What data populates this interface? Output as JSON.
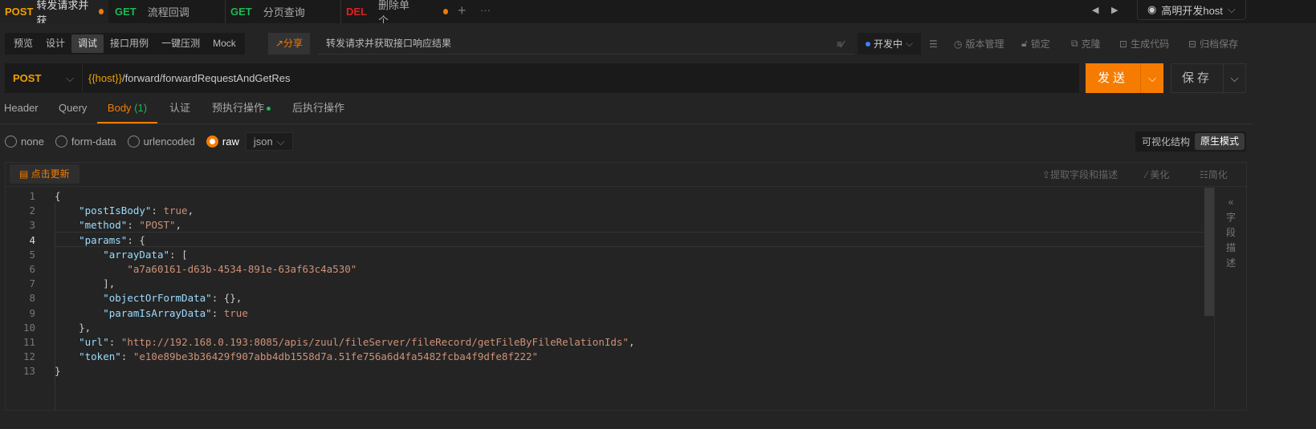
{
  "tabs": [
    {
      "method": "POST",
      "name": "转发请求并获",
      "method_color": "#f0a000",
      "modified": true,
      "active": true
    },
    {
      "method": "GET",
      "name": "流程回调",
      "method_color": "#1db954"
    },
    {
      "method": "GET",
      "name": "分页查询",
      "method_color": "#1db954"
    },
    {
      "method": "DEL",
      "name": "删除单个",
      "method_color": "#e02020",
      "modified": true
    }
  ],
  "tabbar": {
    "add_icon": "+",
    "more_icon": "···",
    "env": "高明开发host"
  },
  "modes": [
    "预览",
    "设计",
    "调试",
    "接口用例",
    "一键压测",
    "Mock"
  ],
  "active_mode": "调试",
  "share": "分享",
  "description": "转发请求并获取接口响应结果",
  "status": "开发中",
  "tools": [
    "版本管理",
    "锁定",
    "克隆",
    "生成代码",
    "归档保存"
  ],
  "request": {
    "method": "POST",
    "url_var": "{{host}}",
    "url_path": "/forward/forwardRequestAndGetRes",
    "send": "发送",
    "save": "保存"
  },
  "param_tabs": [
    {
      "label": "Header"
    },
    {
      "label": "Query"
    },
    {
      "label": "Body",
      "count": "(1)",
      "active": true
    },
    {
      "label": "认证"
    },
    {
      "label": "预执行操作",
      "dot": true
    },
    {
      "label": "后执行操作"
    }
  ],
  "body_types": [
    "none",
    "form-data",
    "urlencoded",
    "raw"
  ],
  "body_selected": "raw",
  "format": "json",
  "view_modes": [
    "可视化结构",
    "原生模式"
  ],
  "view_active": "原生模式",
  "editor_tools": {
    "refresh": "点击更新",
    "extract": "提取字段和描述",
    "beautify": "美化",
    "simplify": "简化",
    "side_panel": "字段描述"
  },
  "code": [
    [
      [
        "p",
        "{"
      ]
    ],
    [
      [
        "p",
        "    "
      ],
      [
        "k",
        "\"postIsBody\""
      ],
      [
        "p",
        ": "
      ],
      [
        "b",
        "true"
      ],
      [
        "p",
        ","
      ]
    ],
    [
      [
        "p",
        "    "
      ],
      [
        "k",
        "\"method\""
      ],
      [
        "p",
        ": "
      ],
      [
        "s",
        "\"POST\""
      ],
      [
        "p",
        ","
      ]
    ],
    [
      [
        "p",
        "    "
      ],
      [
        "k",
        "\"params\""
      ],
      [
        "p",
        ": {"
      ]
    ],
    [
      [
        "p",
        "        "
      ],
      [
        "k",
        "\"arrayData\""
      ],
      [
        "p",
        ": ["
      ]
    ],
    [
      [
        "p",
        "            "
      ],
      [
        "s",
        "\"a7a60161-d63b-4534-891e-63af63c4a530\""
      ]
    ],
    [
      [
        "p",
        "        ],"
      ]
    ],
    [
      [
        "p",
        "        "
      ],
      [
        "k",
        "\"objectOrFormData\""
      ],
      [
        "p",
        ": {},"
      ]
    ],
    [
      [
        "p",
        "        "
      ],
      [
        "k",
        "\"paramIsArrayData\""
      ],
      [
        "p",
        ": "
      ],
      [
        "b",
        "true"
      ]
    ],
    [
      [
        "p",
        "    },"
      ]
    ],
    [
      [
        "p",
        "    "
      ],
      [
        "k",
        "\"url\""
      ],
      [
        "p",
        ": "
      ],
      [
        "s",
        "\"http://192.168.0.193:8085/apis/zuul/fileServer/fileRecord/getFileByFileRelationIds\""
      ],
      [
        "p",
        ","
      ]
    ],
    [
      [
        "p",
        "    "
      ],
      [
        "k",
        "\"token\""
      ],
      [
        "p",
        ": "
      ],
      [
        "s",
        "\"e10e89be3b36429f907abb4db1558d7a.51fe756a6d4fa5482fcba4f9dfe8f222\""
      ]
    ],
    [
      [
        "p",
        "}"
      ]
    ]
  ]
}
